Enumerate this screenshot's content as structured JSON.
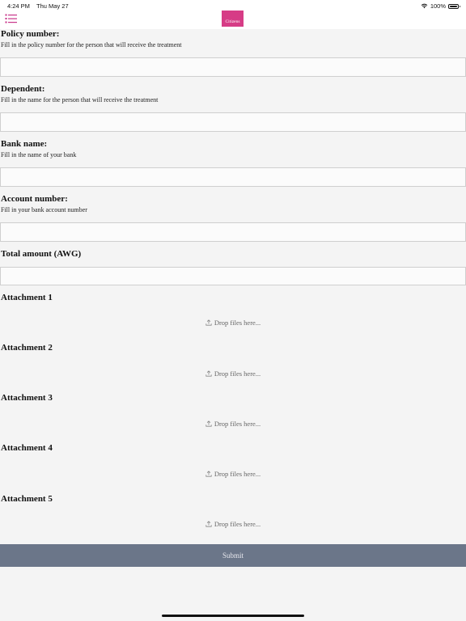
{
  "status_bar": {
    "time": "4:24 PM",
    "date": "Thu May 27",
    "battery": "100%"
  },
  "header": {
    "logo_text": "Citizens"
  },
  "form": {
    "policy": {
      "label": "Policy number:",
      "help": "Fill in the policy number for the person that will receive the treatment",
      "value": ""
    },
    "dependent": {
      "label": "Dependent:",
      "help": "Fill in the name for the person that will receive the treatment",
      "value": ""
    },
    "bank": {
      "label": "Bank name:",
      "help": "Fill in the name of your bank",
      "value": ""
    },
    "account": {
      "label": "Account number:",
      "help": "Fill in your bank account number",
      "value": ""
    },
    "amount": {
      "label": "Total amount (AWG)",
      "value": ""
    },
    "attachments": [
      {
        "label": "Attachment 1",
        "drop_text": "Drop files here..."
      },
      {
        "label": "Attachment 2",
        "drop_text": "Drop files here..."
      },
      {
        "label": "Attachment 3",
        "drop_text": "Drop files here..."
      },
      {
        "label": "Attachment 4",
        "drop_text": "Drop files here..."
      },
      {
        "label": "Attachment 5",
        "drop_text": "Drop files here..."
      }
    ],
    "submit_label": "Submit"
  },
  "colors": {
    "brand": "#d63c86",
    "submit_bg": "#6b7689",
    "page_bg": "#f4f4f4"
  },
  "icons": {
    "menu": "menu-icon",
    "wifi": "wifi-icon",
    "battery": "battery-icon",
    "upload": "upload-icon"
  }
}
